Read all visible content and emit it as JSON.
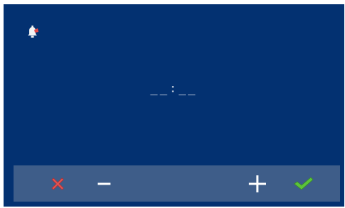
{
  "screen": {
    "time_display": "__:__"
  },
  "icons": {
    "alarm": "alarm-bell-icon",
    "cancel": "red-x-icon",
    "decrement": "minus-icon",
    "increment": "plus-icon",
    "confirm": "green-check-icon"
  },
  "colors": {
    "background": "#033171",
    "toolbar": "#3e5d89",
    "cancel": "#e05555",
    "confirm": "#5bc43a",
    "foreground": "#ffffff"
  }
}
